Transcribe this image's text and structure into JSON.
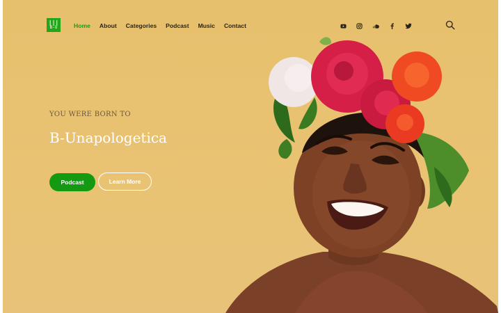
{
  "logo": {
    "mark": "B-U"
  },
  "nav": {
    "items": [
      "Home",
      "About",
      "Categories",
      "Podcast",
      "Music",
      "Contact"
    ],
    "active": "Home",
    "accent": "#1f9a15"
  },
  "social": [
    "youtube-icon",
    "instagram-icon",
    "soundcloud-icon",
    "facebook-icon",
    "twitter-icon"
  ],
  "hero": {
    "eyebrow": "YOU WERE BORN TO",
    "title": "B-Unapologetica",
    "primary_button": "Podcast",
    "secondary_button": "Learn More",
    "background": "#e8c274",
    "button_color": "#139a12"
  }
}
